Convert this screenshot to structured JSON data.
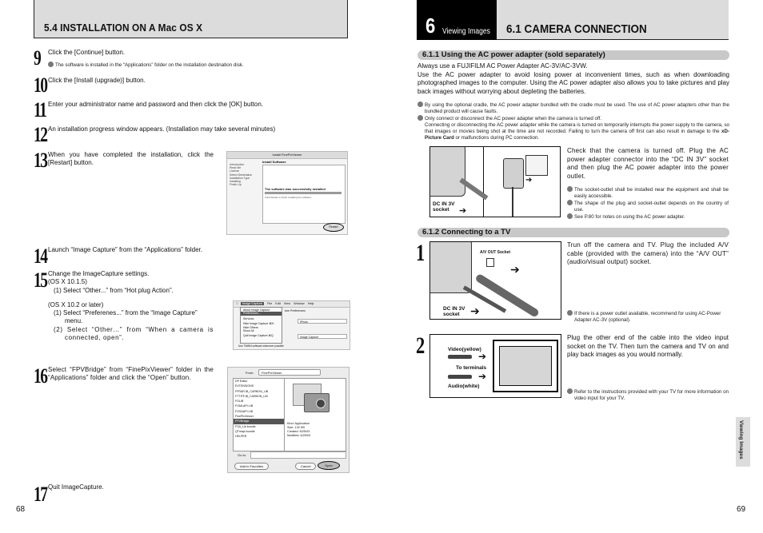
{
  "left_page": {
    "header_title": "5.4 INSTALLATION ON A Mac OS X",
    "steps": [
      {
        "num": "9",
        "text": "Click the [Continue] button.",
        "note": "The software is installed in the “Applications” folder on the installation destination disk."
      },
      {
        "num": "10",
        "text": "Click the [Install (upgrade)] button."
      },
      {
        "num": "11",
        "text": "Enter your administrator name and password and then click the [OK] button."
      },
      {
        "num": "12",
        "text": "An installation progress window appears. (Installation may take several minutes)"
      },
      {
        "num": "13",
        "text": "When you have completed the installation, click the [Restart] button."
      },
      {
        "num": "14",
        "text": "Launch “Image Capture” from the “Applications” folder."
      },
      {
        "num": "15",
        "text": "Change the ImageCapture settings.",
        "sub": [
          "(OS X 10.1.5)",
          "(1) Select “Other...” from “Hot plug Action”.",
          "(OS X 10.2 or later)",
          "(1) Select “Preferenes...” from the “Image Capture” menu.",
          "(2) Select “Other…” from “When a camera is connected, open”."
        ]
      },
      {
        "num": "16",
        "text": "Select “FPVBridge” from “FinePixViewer” folder in the “Applications” folder and click the “Open” button."
      },
      {
        "num": "17",
        "text": "Quit ImageCapture."
      }
    ],
    "screenshot_install": {
      "window_title": "Install FinePixViewer",
      "heading": "Install Software",
      "sidebar": [
        "Introduction",
        "Read Me",
        "License",
        "Select Destination",
        "Installation Type",
        "Installing",
        "Finish Up"
      ],
      "success": "The software was successfully installed",
      "hint": "Click Restart to finish installing the software.",
      "button": "Restart"
    },
    "screenshot_menu": {
      "menubar": [
        "Image Capture",
        "File",
        "Edit",
        "View",
        "Window",
        "Help"
      ],
      "items": [
        "About Image Capture",
        "Preferences...",
        "Services",
        "Hide Image Capture",
        "Hide Others",
        "Show All",
        "Quit Image Capture"
      ],
      "shortcuts": {
        "hide": "⌘H",
        "quit": "⌘Q"
      },
      "pref_title": "ture Preferences",
      "select1": "iPhoto",
      "select2": "Image Capture",
      "checkbox": "Use TWAIN software whenever possible"
    },
    "screenshot_open": {
      "from_label": "From:",
      "from_value": "FinePixViewer",
      "files": [
        "DP Editor",
        "EXTENSIONS",
        "FFRAR.IB_CARBON_LIB",
        "FTTIFF.IB_CARBON_LIB",
        "FGLIB",
        "FGMLAPI.LIB",
        "FGSAAPI.LIB",
        "FinePixViewer",
        "FPVBridge",
        "FSA_Lib.bundle",
        "QTmapi.bundle",
        "HELPER"
      ],
      "selected": "FPVBridge",
      "info": [
        "Kind: Application",
        "Size: 132 KB",
        "Created: 6/25/03",
        "Modified: 6/25/03"
      ],
      "goto_label": "Go to:",
      "btn_fav": "Add to Favorites",
      "btn_cancel": "Cancel",
      "btn_open": "Open"
    },
    "page_number": "68"
  },
  "right_page": {
    "chapter_num": "6",
    "chapter_label": "Viewing Images",
    "header_title": "6.1 CAMERA CONNECTION",
    "sec1": {
      "title": "6.1.1 Using the AC power adapter (sold separately)",
      "para1": "Always use a FUJIFILM AC Power Adapter AC-3V/AC-3VW.",
      "para2": "Use the AC power adapter to avoid losing power at inconvenient times, such as when downloading photographed images to the computer. Using the AC power adapter also allows you to take pictures and play back images without worrying about depleting the batteries.",
      "note1": "By using the optional cradle, the AC power adapter bundled with the cradle must be used. The use of AC power adapters other than the bundled product will cause faults.",
      "note2_a": "Only connect or disconnect the AC power adapter when the camera is turned off.",
      "note2_b": "Connecting or disconnecting the AC power adapter while the camera is turned on temporarily interrupts the power supply to the camera, so that images or movies being shot at the time are not recorded. Failing to turn the camera off first can also result in damage to the ",
      "note2_bold": "xD-Picture Card",
      "note2_c": " or malfunctions during PC connection.",
      "fig_label": "DC IN 3V socket",
      "desc": "Check that the camera is turned off. Plug the AC power adapter connector into the “DC IN 3V” socket and then plug the AC power adapter into the power outlet.",
      "notes": [
        "The socket-outlet shall be installed near the equipment and shall be easily accessible.",
        "The shape of the plug and socket-outlet depends on the country of use.",
        "See P.80 for notes on using the AC power adapter."
      ]
    },
    "sec2": {
      "title": "6.1.2 Connecting to a TV",
      "step1": {
        "num": "1",
        "fig_socket": "A/V OUT Socket",
        "fig_dc": "DC IN 3V socket",
        "desc": "Trun off the camera and TV. Plug the included A/V cable (provided with the camera) into the “A/V OUT” (audio/visual output) socket.",
        "note": "If there is a power outlet available, recommend for using AC-Power Adapter AC-3V (optional)."
      },
      "step2": {
        "num": "2",
        "fig_video": "Video(yellow)",
        "fig_terminals": "To terminals",
        "fig_audio": "Audio(white)",
        "desc": "Plug the other end of the cable into the video input socket on the TV. Then turn the camera and TV on and play back images as you would normally.",
        "note": "Refer to the instructions provided with your TV for more information on video input for your TV."
      }
    },
    "side_tab": "Viewing Images",
    "page_number": "69"
  }
}
